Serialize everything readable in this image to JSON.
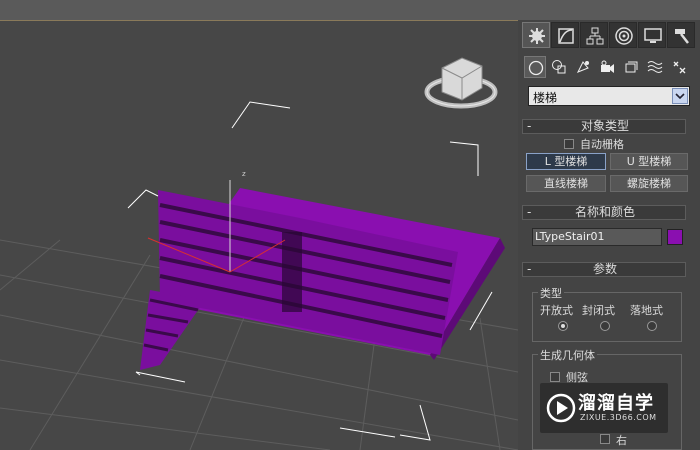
{
  "command_panel": {
    "tabs": [
      "create-tab",
      "modify-tab",
      "hierarchy-tab",
      "motion-tab",
      "display-tab",
      "utilities-tab"
    ],
    "category_icons": [
      "geometry-icon",
      "shapes-icon",
      "lights-icon",
      "cameras-icon",
      "helpers-icon",
      "spacewarps-icon",
      "systems-icon"
    ],
    "category_dropdown": "楼梯",
    "object_type": {
      "title": "对象类型",
      "autogrid_label": "自动栅格",
      "buttons": [
        "L 型楼梯",
        "U 型楼梯",
        "直线楼梯",
        "螺旋楼梯"
      ]
    },
    "name_color": {
      "title": "名称和颜色",
      "name_value": "LTypeStair01",
      "color": "#8a0fb0"
    },
    "parameters": {
      "title": "参数",
      "type_group_label": "类型",
      "type_options": [
        "开放式",
        "封闭式",
        "落地式"
      ],
      "selected_type": "开放式",
      "generate_geometry_label": "生成几何体",
      "side_label": "侧弦",
      "partial_label": "右"
    }
  },
  "watermark": {
    "title": "溜溜自学",
    "url": "ZIXUE.3D66.COM"
  },
  "colors": {
    "stair_purple": "#8a0fb0",
    "stair_dark": "#3a0a4a",
    "viewport_bg": "#474747",
    "grid": "#5e5e5e"
  }
}
